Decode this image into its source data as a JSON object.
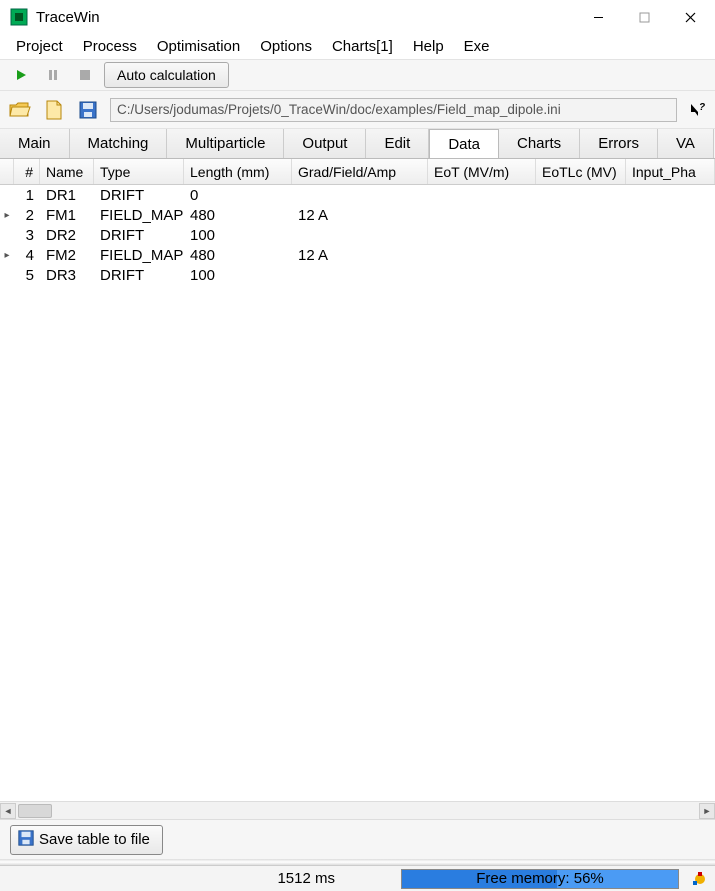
{
  "window": {
    "title": "TraceWin"
  },
  "menubar": {
    "items": [
      "Project",
      "Process",
      "Optimisation",
      "Options",
      "Charts[1]",
      "Help",
      "Exe"
    ]
  },
  "toolbar": {
    "play_icon": "play-icon",
    "pause_icon": "pause-icon",
    "stop_icon": "stop-icon",
    "autocalc_label": "Auto calculation"
  },
  "pathbar": {
    "path": "C:/Users/jodumas/Projets/0_TraceWin/doc/examples/Field_map_dipole.ini"
  },
  "tabs": {
    "items": [
      "Main",
      "Matching",
      "Multiparticle",
      "Output",
      "Edit",
      "Data",
      "Charts",
      "Errors",
      "VA"
    ],
    "active": "Data"
  },
  "table": {
    "headers": {
      "num": "#",
      "name": "Name",
      "type": "Type",
      "length": "Length (mm)",
      "gfa": "Grad/Field/Amp",
      "eot": "EoT (MV/m)",
      "eotlc": "EoTLc (MV)",
      "inph": "Input_Pha"
    },
    "rows": [
      {
        "expand": "",
        "num": "1",
        "name": "DR1",
        "type": "DRIFT",
        "length": "0",
        "gfa": "",
        "eot": "",
        "eotlc": "",
        "inph": ""
      },
      {
        "expand": "▸",
        "num": "2",
        "name": "FM1",
        "type": "FIELD_MAP",
        "length": "480",
        "gfa": "12 A",
        "eot": "",
        "eotlc": "",
        "inph": ""
      },
      {
        "expand": "",
        "num": "3",
        "name": "DR2",
        "type": "DRIFT",
        "length": "100",
        "gfa": "",
        "eot": "",
        "eotlc": "",
        "inph": ""
      },
      {
        "expand": "▸",
        "num": "4",
        "name": "FM2",
        "type": "FIELD_MAP",
        "length": "480",
        "gfa": "12 A",
        "eot": "",
        "eotlc": "",
        "inph": ""
      },
      {
        "expand": "",
        "num": "5",
        "name": "DR3",
        "type": "DRIFT",
        "length": "100",
        "gfa": "",
        "eot": "",
        "eotlc": "",
        "inph": ""
      }
    ]
  },
  "save_button": {
    "label": "Save table to file"
  },
  "statusbar": {
    "time": "1512 ms",
    "memory_label": "Free memory: 56%",
    "memory_percent": 56
  },
  "colors": {
    "accent": "#2a7de0"
  }
}
